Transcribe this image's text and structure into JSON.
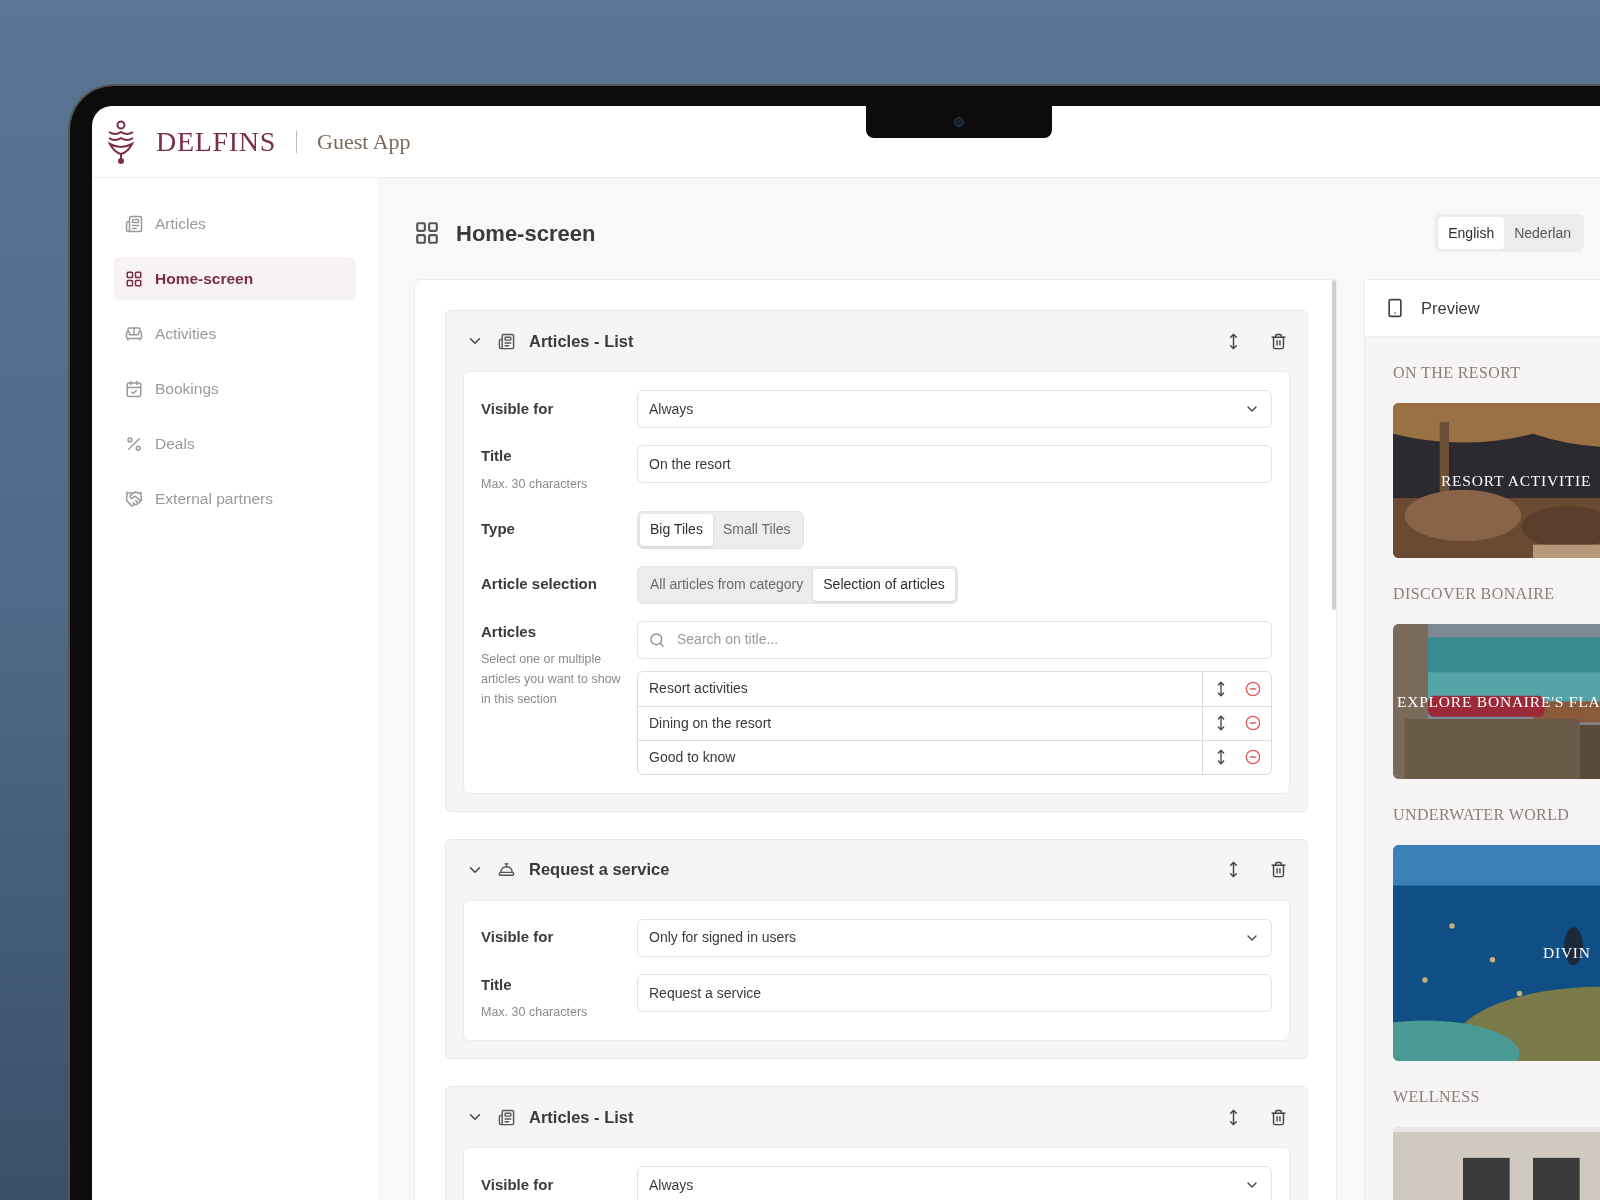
{
  "brand": {
    "name": "DELFINS",
    "app": "Guest App"
  },
  "sidebar": {
    "items": [
      {
        "label": "Articles",
        "selected": false
      },
      {
        "label": "Home-screen",
        "selected": true
      },
      {
        "label": "Activities",
        "selected": false
      },
      {
        "label": "Bookings",
        "selected": false
      },
      {
        "label": "Deals",
        "selected": false
      },
      {
        "label": "External partners",
        "selected": false
      }
    ]
  },
  "page": {
    "title": "Home-screen"
  },
  "languages": [
    {
      "label": "English",
      "selected": true
    },
    {
      "label": "Nederlan",
      "selected": false
    }
  ],
  "sections": [
    {
      "kind": "articles",
      "title": "Articles - List",
      "expanded": true,
      "fields": [
        {
          "kind": "select",
          "label": "Visible for",
          "value": "Always"
        },
        {
          "kind": "text",
          "label": "Title",
          "hint": "Max. 30 characters",
          "value": "On the resort"
        },
        {
          "kind": "segmented",
          "label": "Type",
          "options": [
            {
              "label": "Big Tiles",
              "selected": true
            },
            {
              "label": "Small Tiles",
              "selected": false
            }
          ]
        },
        {
          "kind": "segmented",
          "label": "Article selection",
          "options": [
            {
              "label": "All articles from category",
              "selected": false
            },
            {
              "label": "Selection of articles",
              "selected": true
            }
          ]
        },
        {
          "kind": "articles",
          "label": "Articles",
          "hint": "Select one or multiple articles you want to show in this section",
          "placeholder": "Search on title...",
          "items": [
            "Resort activities",
            "Dining on the resort",
            "Good to know"
          ]
        }
      ]
    },
    {
      "kind": "service",
      "title": "Request a service",
      "expanded": true,
      "fields": [
        {
          "kind": "select",
          "label": "Visible for",
          "value": "Only for signed in users"
        },
        {
          "kind": "text",
          "label": "Title",
          "hint": "Max. 30 characters",
          "value": "Request a service"
        }
      ]
    },
    {
      "kind": "articles",
      "title": "Articles - List",
      "expanded": true,
      "fields": [
        {
          "kind": "select",
          "label": "Visible for",
          "value": "Always"
        }
      ]
    }
  ],
  "preview": {
    "title": "Preview",
    "groups": [
      {
        "heading": "ON THE RESORT",
        "caption": "RESORT ACTIVITIE",
        "kind": "picture"
      },
      {
        "heading": "DISCOVER BONAIRE",
        "caption": "EXPLORE BONAIRE'S FLA",
        "kind": "picture"
      },
      {
        "heading": "UNDERWATER WORLD",
        "caption": "DIVIN",
        "kind": "picture"
      },
      {
        "heading": "WELLNESS",
        "kind": "picture"
      }
    ]
  }
}
